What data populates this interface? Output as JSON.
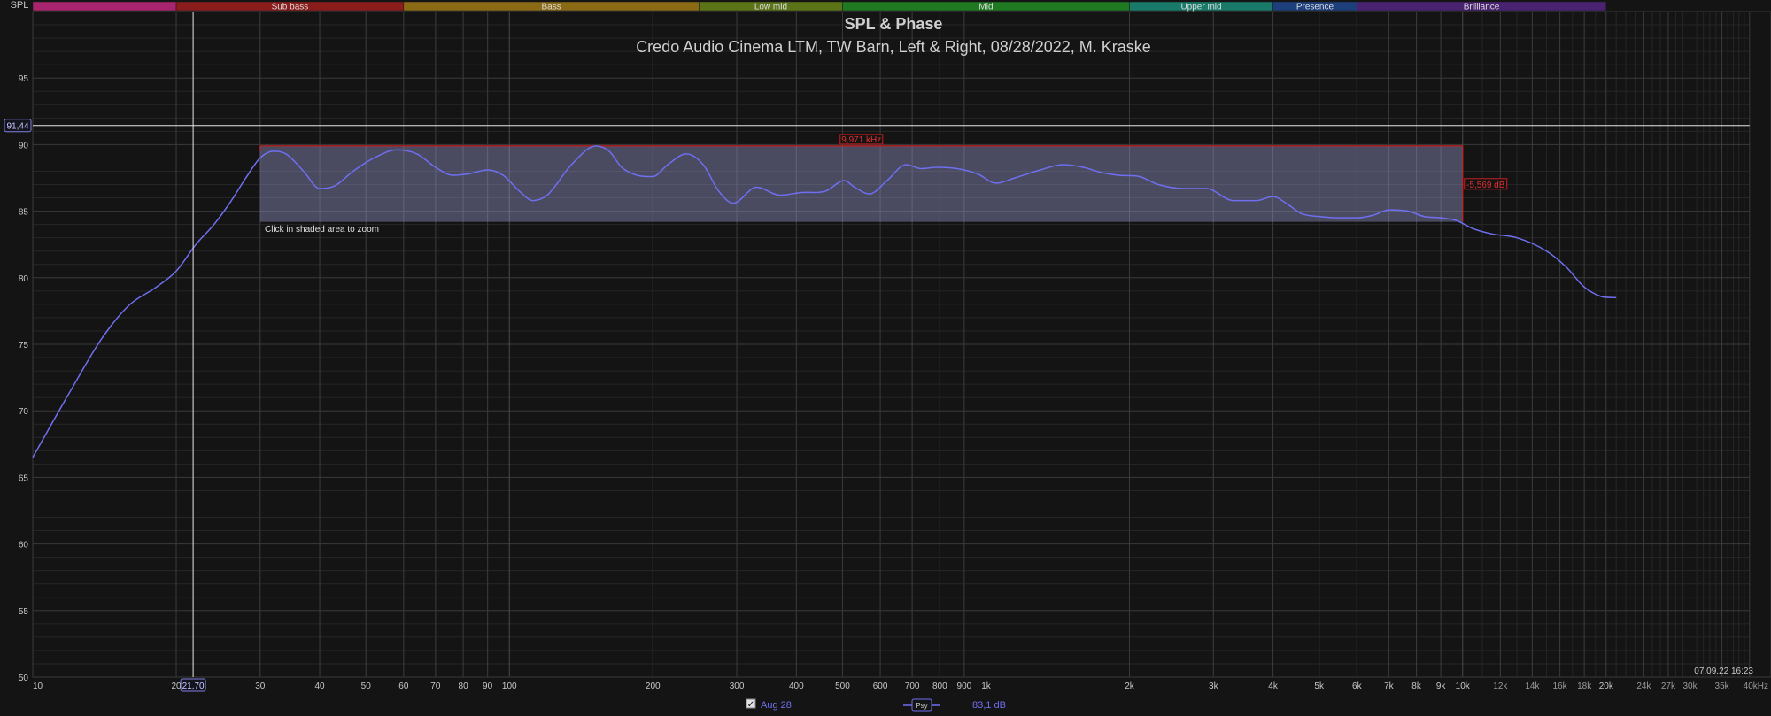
{
  "chart_data": {
    "type": "line",
    "title": "SPL & Phase",
    "subtitle": "Credo Audio Cinema LTM, TW Barn, Left & Right, 08/28/2022, M. Kraske",
    "axis_label": "SPL",
    "x_scale": "log",
    "xlim": [
      10,
      40000
    ],
    "ylim": [
      50,
      100
    ],
    "grid": true,
    "x_ticks": [
      {
        "v": 10,
        "t": "10"
      },
      {
        "v": 20,
        "t": "20"
      },
      {
        "v": 30,
        "t": "30"
      },
      {
        "v": 40,
        "t": "40"
      },
      {
        "v": 50,
        "t": "50"
      },
      {
        "v": 60,
        "t": "60"
      },
      {
        "v": 70,
        "t": "70"
      },
      {
        "v": 80,
        "t": "80"
      },
      {
        "v": 90,
        "t": "90"
      },
      {
        "v": 100,
        "t": "100"
      },
      {
        "v": 200,
        "t": "200"
      },
      {
        "v": 300,
        "t": "300"
      },
      {
        "v": 400,
        "t": "400"
      },
      {
        "v": 500,
        "t": "500"
      },
      {
        "v": 600,
        "t": "600"
      },
      {
        "v": 700,
        "t": "700"
      },
      {
        "v": 800,
        "t": "800"
      },
      {
        "v": 900,
        "t": "900"
      },
      {
        "v": 1000,
        "t": "1k"
      },
      {
        "v": 2000,
        "t": "2k"
      },
      {
        "v": 3000,
        "t": "3k"
      },
      {
        "v": 4000,
        "t": "4k"
      },
      {
        "v": 5000,
        "t": "5k"
      },
      {
        "v": 6000,
        "t": "6k"
      },
      {
        "v": 7000,
        "t": "7k"
      },
      {
        "v": 8000,
        "t": "8k"
      },
      {
        "v": 9000,
        "t": "9k"
      },
      {
        "v": 10000,
        "t": "10k"
      },
      {
        "v": 12000,
        "t": "12k"
      },
      {
        "v": 14000,
        "t": "14k"
      },
      {
        "v": 16000,
        "t": "16k"
      },
      {
        "v": 18000,
        "t": "18k"
      },
      {
        "v": 20000,
        "t": "20k"
      },
      {
        "v": 24000,
        "t": "24k"
      },
      {
        "v": 27000,
        "t": "27k"
      },
      {
        "v": 30000,
        "t": "30k"
      },
      {
        "v": 35000,
        "t": "35k"
      },
      {
        "v": 40000,
        "t": "40kHz"
      }
    ],
    "y_ticks": [
      {
        "v": 50,
        "t": "50"
      },
      {
        "v": 55,
        "t": "55"
      },
      {
        "v": 60,
        "t": "60"
      },
      {
        "v": 65,
        "t": "65"
      },
      {
        "v": 70,
        "t": "70"
      },
      {
        "v": 75,
        "t": "75"
      },
      {
        "v": 80,
        "t": "80"
      },
      {
        "v": 85,
        "t": "85"
      },
      {
        "v": 90,
        "t": "90"
      },
      {
        "v": 95,
        "t": "95"
      }
    ],
    "bands": [
      {
        "name": "",
        "start": 10,
        "end": 20,
        "color": "#a8246e"
      },
      {
        "name": "Sub bass",
        "start": 20,
        "end": 60,
        "color": "#8a1c1c"
      },
      {
        "name": "Bass",
        "start": 60,
        "end": 250,
        "color": "#8a6a14"
      },
      {
        "name": "Low mid",
        "start": 250,
        "end": 500,
        "color": "#5c7418"
      },
      {
        "name": "Mid",
        "start": 500,
        "end": 2000,
        "color": "#1f7a22"
      },
      {
        "name": "Upper mid",
        "start": 2000,
        "end": 4000,
        "color": "#197a6a"
      },
      {
        "name": "Presence",
        "start": 4000,
        "end": 6000,
        "color": "#1d3f7c"
      },
      {
        "name": "Brilliance",
        "start": 6000,
        "end": 20000,
        "color": "#4a2272"
      }
    ],
    "series": [
      {
        "name": "Aug 28",
        "color": "#6f6ff0",
        "points": [
          [
            10,
            66.5
          ],
          [
            12,
            71.5
          ],
          [
            14,
            75.5
          ],
          [
            16,
            78
          ],
          [
            18,
            79.2
          ],
          [
            20,
            80.5
          ],
          [
            22,
            82.5
          ],
          [
            24,
            84
          ],
          [
            26,
            85.7
          ],
          [
            28,
            87.5
          ],
          [
            30,
            89
          ],
          [
            32,
            89.5
          ],
          [
            34,
            89.3
          ],
          [
            37,
            88
          ],
          [
            40,
            86.7
          ],
          [
            43,
            86.9
          ],
          [
            47,
            88
          ],
          [
            52,
            89
          ],
          [
            58,
            89.6
          ],
          [
            64,
            89.3
          ],
          [
            70,
            88.3
          ],
          [
            76,
            87.7
          ],
          [
            82,
            87.8
          ],
          [
            90,
            88.1
          ],
          [
            97,
            87.7
          ],
          [
            105,
            86.5
          ],
          [
            112,
            85.8
          ],
          [
            120,
            86.2
          ],
          [
            135,
            88.5
          ],
          [
            152,
            89.9
          ],
          [
            162,
            89.5
          ],
          [
            172,
            88.3
          ],
          [
            185,
            87.7
          ],
          [
            200,
            87.6
          ],
          [
            215,
            88.5
          ],
          [
            235,
            89.3
          ],
          [
            255,
            88.5
          ],
          [
            275,
            86.5
          ],
          [
            295,
            85.6
          ],
          [
            330,
            86.8
          ],
          [
            370,
            86.2
          ],
          [
            410,
            86.4
          ],
          [
            460,
            86.5
          ],
          [
            505,
            87.3
          ],
          [
            530,
            86.8
          ],
          [
            570,
            86.3
          ],
          [
            620,
            87.3
          ],
          [
            680,
            88.5
          ],
          [
            730,
            88.2
          ],
          [
            790,
            88.3
          ],
          [
            870,
            88.2
          ],
          [
            960,
            87.8
          ],
          [
            1050,
            87.1
          ],
          [
            1150,
            87.5
          ],
          [
            1300,
            88.1
          ],
          [
            1450,
            88.5
          ],
          [
            1600,
            88.3
          ],
          [
            1750,
            87.9
          ],
          [
            1900,
            87.7
          ],
          [
            2100,
            87.6
          ],
          [
            2300,
            87
          ],
          [
            2600,
            86.7
          ],
          [
            2900,
            86.7
          ],
          [
            3300,
            85.8
          ],
          [
            3700,
            85.8
          ],
          [
            4000,
            86.1
          ],
          [
            4300,
            85.5
          ],
          [
            4600,
            84.8
          ],
          [
            5000,
            84.6
          ],
          [
            5500,
            84.5
          ],
          [
            6000,
            84.5
          ],
          [
            6500,
            84.7
          ],
          [
            7000,
            85.1
          ],
          [
            7700,
            85
          ],
          [
            8300,
            84.6
          ],
          [
            9000,
            84.5
          ],
          [
            9700,
            84.3
          ],
          [
            10500,
            83.7
          ],
          [
            11500,
            83.3
          ],
          [
            13000,
            83
          ],
          [
            15000,
            82
          ],
          [
            16500,
            80.8
          ],
          [
            18000,
            79.3
          ],
          [
            19500,
            78.6
          ],
          [
            21000,
            78.5
          ]
        ]
      }
    ],
    "selection": {
      "f_start": 30,
      "f_end": 10000,
      "db_top": 89.9,
      "db_bottom": 84.2,
      "freq_label": "9,971 kHz",
      "db_label": "-5,569 dB"
    },
    "hint_text": "Click in shaded area to zoom",
    "cursor": {
      "freq": 21.7,
      "freq_label": "21,70",
      "db": 91.44,
      "db_label": "91,44"
    },
    "timestamp": "07.09.22 16:23",
    "legend": {
      "checkbox_checked": true,
      "checkbox_symbol": "✓",
      "series_name": "Aug 28",
      "smoothing_label": "Psy",
      "value_text": "83,1 dB"
    },
    "colors": {
      "background": "#141414",
      "grid_major": "#3a3a3a",
      "grid_minor": "#262626",
      "text": "#c8c8c8",
      "trace": "#6f6ff0",
      "selection_border": "#c81e1e",
      "cursor": "#e6e6e6"
    }
  }
}
